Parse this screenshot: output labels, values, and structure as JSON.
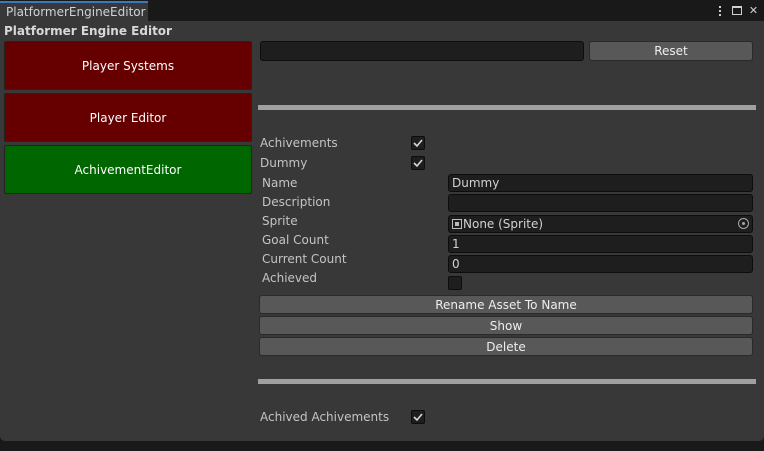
{
  "tab": {
    "title": "PlatformerEngineEditor"
  },
  "header": {
    "title": "Platformer Engine Editor"
  },
  "sidebar": {
    "items": [
      {
        "label": "Player Systems",
        "color": "#660000"
      },
      {
        "label": "Player Editor",
        "color": "#660000"
      },
      {
        "label": "AchivementEditor",
        "color": "#006600"
      }
    ]
  },
  "toolbar": {
    "path_value": "",
    "reset_label": "Reset"
  },
  "achievements": {
    "list_label": "Achivements",
    "list_checked": true,
    "item_label": "Dummy",
    "item_checked": true,
    "fields": {
      "name_label": "Name",
      "name_value": "Dummy",
      "description_label": "Description",
      "description_value": "",
      "sprite_label": "Sprite",
      "sprite_value": "None (Sprite)",
      "goal_label": "Goal Count",
      "goal_value": "1",
      "current_label": "Current Count",
      "current_value": "0",
      "achieved_label": "Achieved",
      "achieved_checked": false
    },
    "buttons": {
      "rename": "Rename Asset To Name",
      "show": "Show",
      "delete": "Delete"
    },
    "achieved_list_label": "Achived Achivements",
    "achieved_list_checked": true
  },
  "colors": {
    "accent": "#3a79bb",
    "panel_bg": "#383838",
    "field_bg": "#1e1e1e",
    "button_bg": "#585858"
  }
}
